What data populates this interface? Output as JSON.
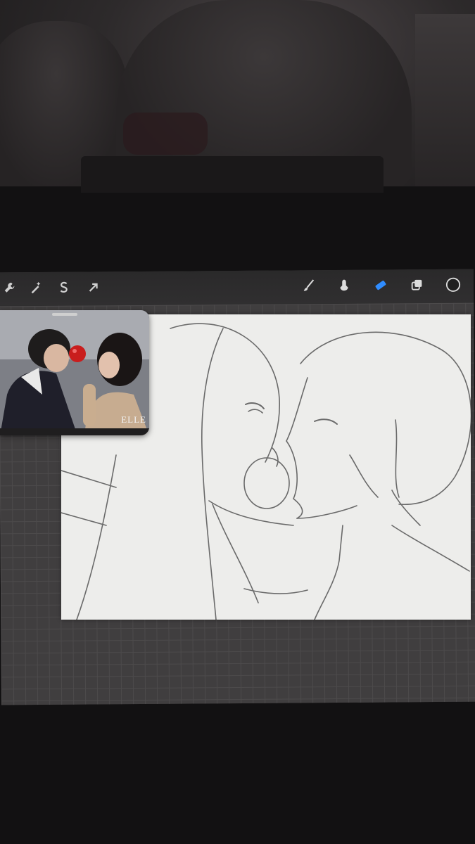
{
  "app": {
    "name": ""
  },
  "toolbar": {
    "left_tools": [
      {
        "icon": "wrench-actions-icon"
      },
      {
        "icon": "adjustments-magic-wand-icon"
      },
      {
        "icon": "selection-s-icon"
      },
      {
        "icon": "transform-arrow-icon"
      }
    ],
    "right_tools": [
      {
        "icon": "brush-icon"
      },
      {
        "icon": "smudge-icon"
      },
      {
        "icon": "eraser-icon",
        "active": true
      },
      {
        "icon": "layers-icon"
      },
      {
        "icon": "color-swatch-icon"
      }
    ],
    "active_color": "#1f1f1f",
    "accent": "#2f8cff"
  },
  "reference": {
    "watermark": "ELLE"
  },
  "canvas": {
    "background": "#ededeb",
    "stroke": "#5a5a5a"
  }
}
